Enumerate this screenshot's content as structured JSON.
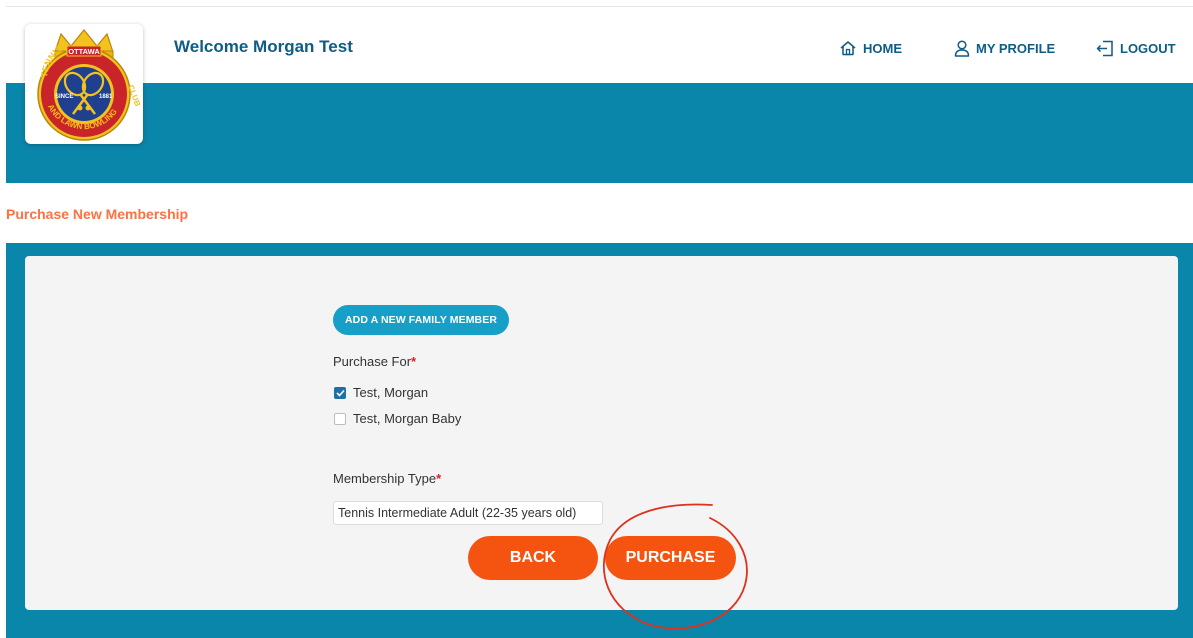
{
  "header": {
    "welcome": "Welcome Morgan Test",
    "nav": {
      "home": "HOME",
      "profile": "MY PROFILE",
      "logout": "LOGOUT"
    }
  },
  "logo": {
    "top_text": "OTTAWA",
    "since": "SINCE",
    "year": "1881",
    "left_text": "TENNIS",
    "bottom_text": "AND LAWN BOWLING",
    "right_text": "CLUB"
  },
  "page": {
    "title": "Purchase New Membership"
  },
  "form": {
    "add_member_label": "ADD A NEW FAMILY MEMBER",
    "purchase_for_label": "Purchase For",
    "required_mark": "*",
    "members": [
      {
        "name": "Test, Morgan",
        "checked": true
      },
      {
        "name": "Test, Morgan Baby",
        "checked": false
      }
    ],
    "membership_type_label": "Membership Type",
    "membership_type_value": "Tennis Intermediate Adult (22-35 years old)",
    "back_label": "BACK",
    "purchase_label": "PURCHASE"
  },
  "colors": {
    "brand_blue": "#0a86aa",
    "nav_text": "#0f5c84",
    "accent_orange": "#f55410",
    "title_orange": "#ff7043",
    "annotation_red": "#e0301e"
  },
  "icons": {
    "home": "home-icon",
    "profile": "user-icon",
    "logout": "logout-icon"
  }
}
